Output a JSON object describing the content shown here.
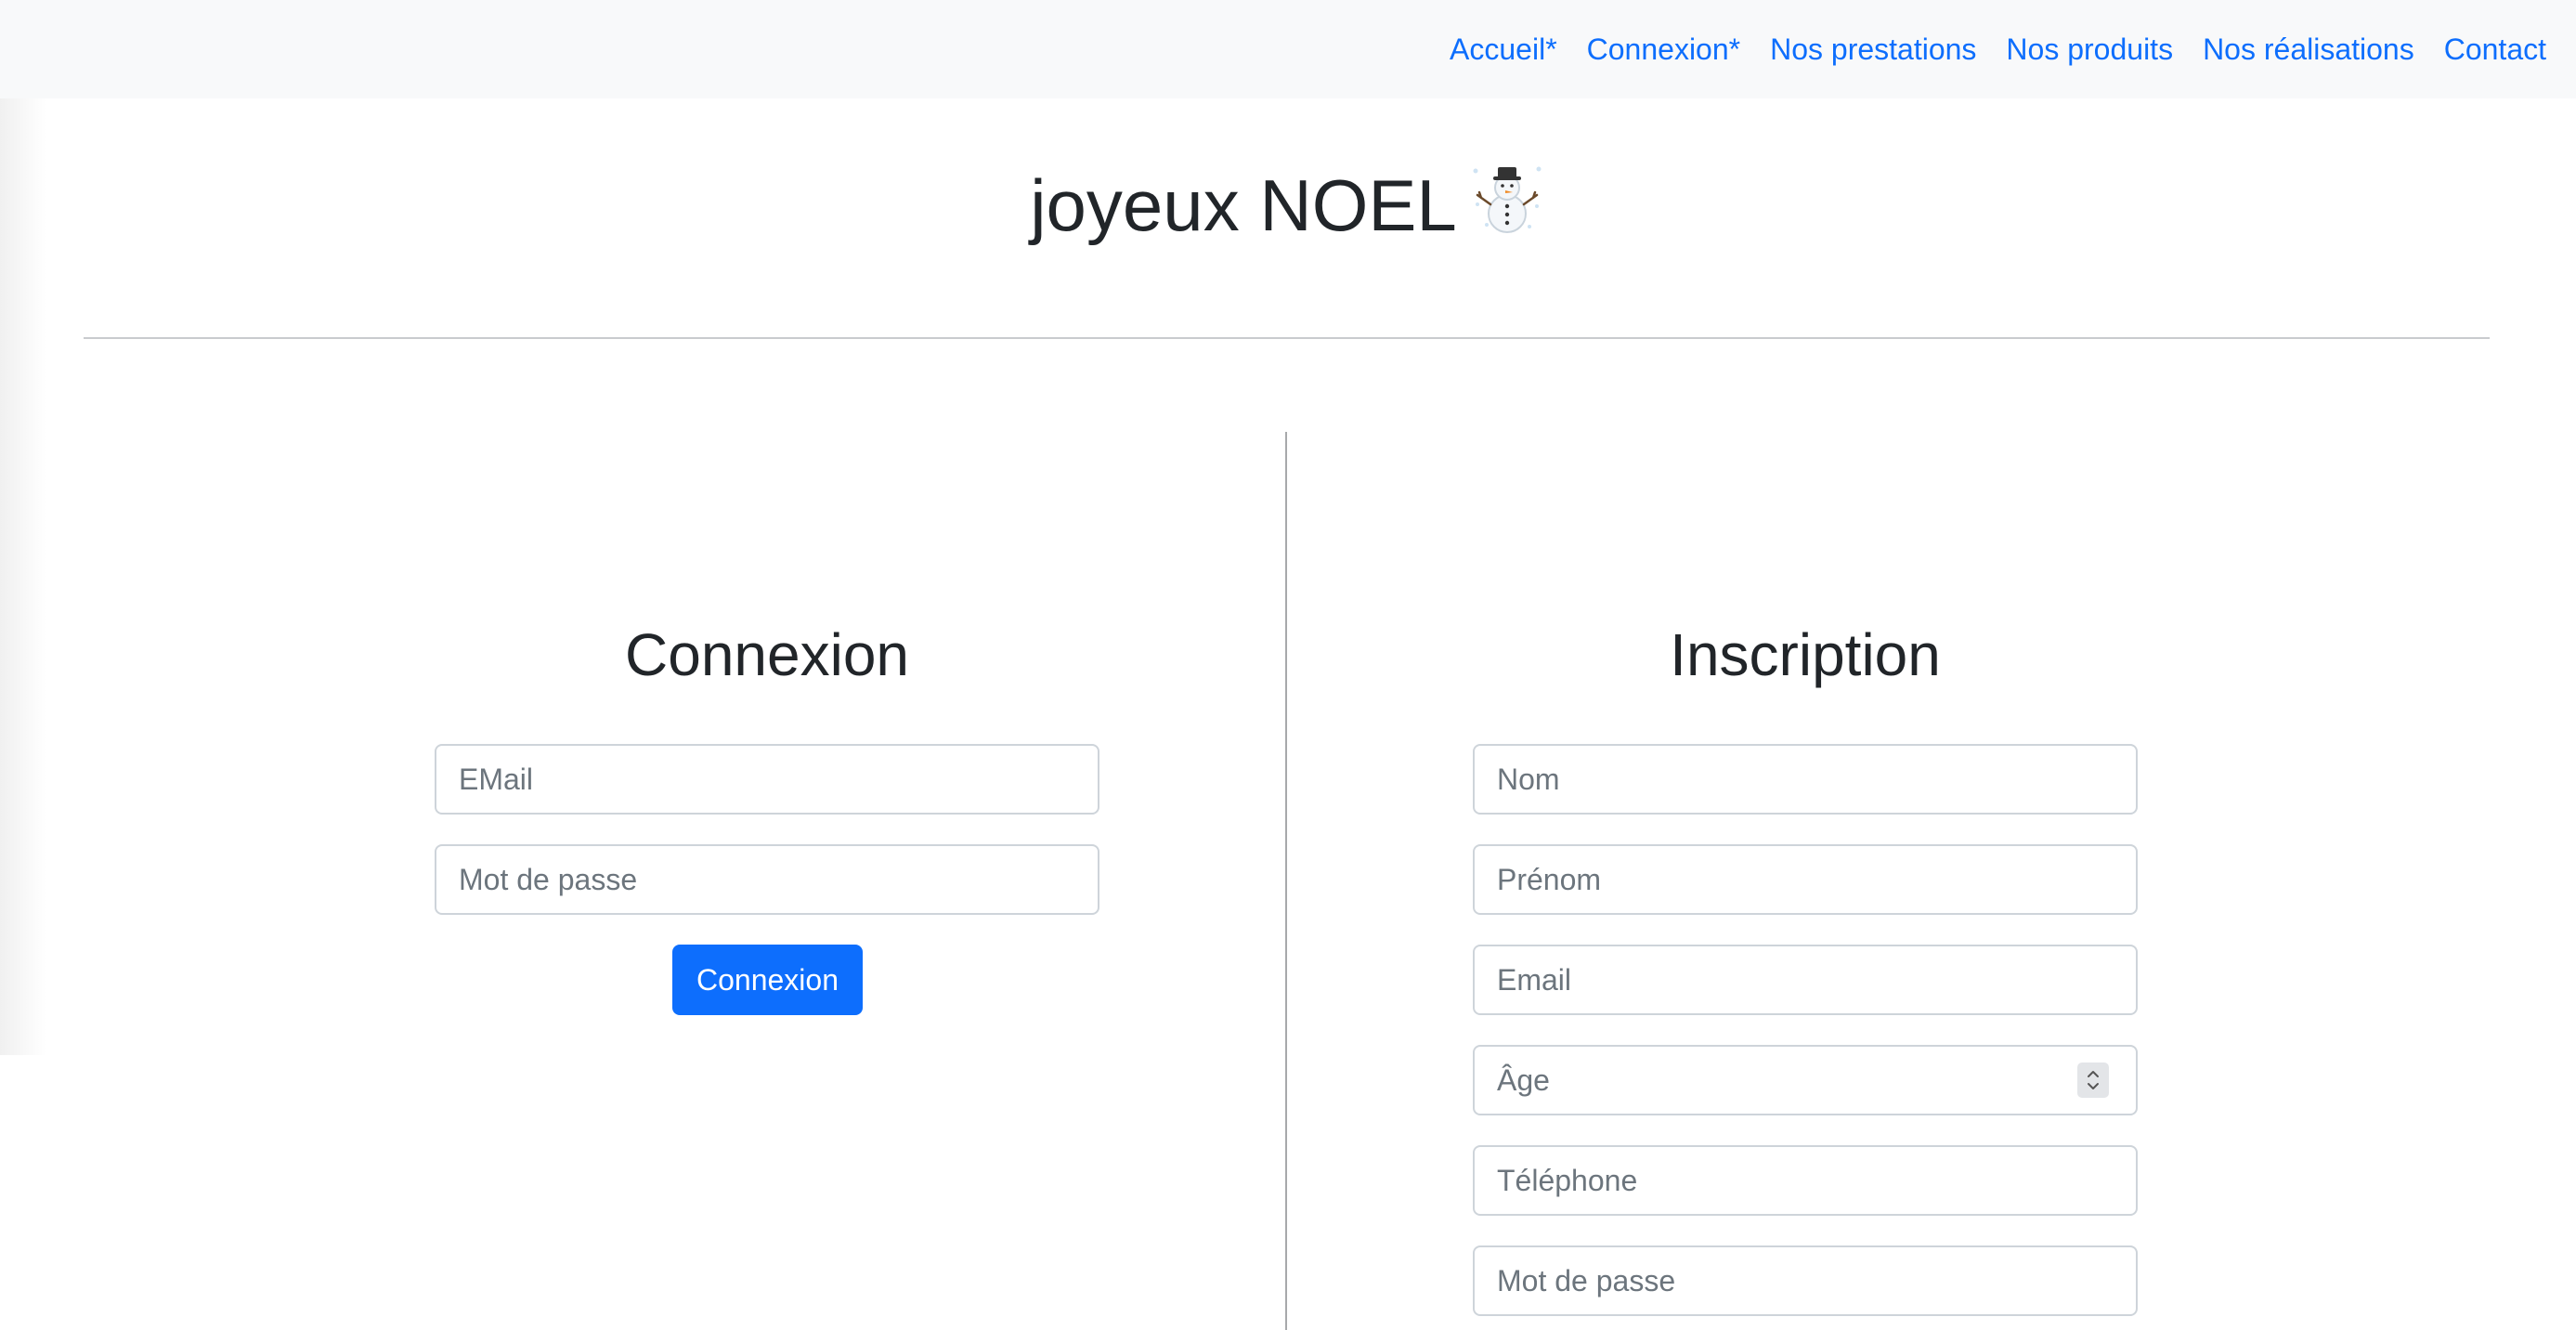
{
  "nav": {
    "items": [
      "Accueil*",
      "Connexion*",
      "Nos prestations",
      "Nos produits",
      "Nos réalisations",
      "Contact"
    ]
  },
  "page": {
    "title": "joyeux NOEL",
    "title_icon": "snowman-icon"
  },
  "login": {
    "heading": "Connexion",
    "email_placeholder": "EMail",
    "password_placeholder": "Mot de passe",
    "submit_label": "Connexion",
    "accent_color": "#0d6efd"
  },
  "signup": {
    "heading": "Inscription",
    "nom_placeholder": "Nom",
    "prenom_placeholder": "Prénom",
    "email_placeholder": "Email",
    "age_placeholder": "Âge",
    "telephone_placeholder": "Téléphone",
    "password_placeholder": "Mot de passe"
  }
}
